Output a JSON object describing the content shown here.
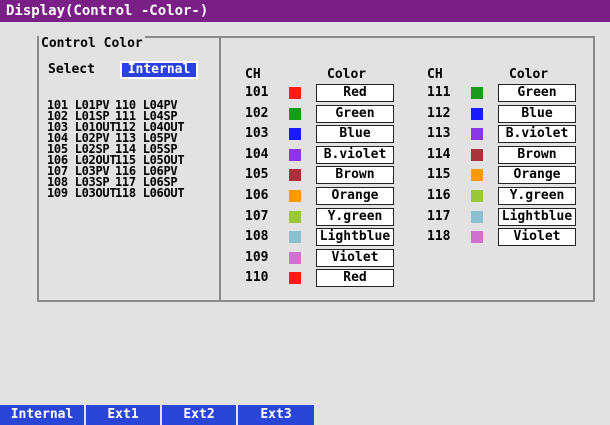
{
  "title": "Display(Control -Color-)",
  "section_label": "Control Color",
  "select": {
    "label": "Select",
    "value": "Internal"
  },
  "tags": [
    [
      "101 L01PV",
      "110 L04PV"
    ],
    [
      "102 L01SP",
      "111 L04SP"
    ],
    [
      "103 L01OUT",
      "112 L04OUT"
    ],
    [
      "104 L02PV",
      "113 L05PV"
    ],
    [
      "105 L02SP",
      "114 L05SP"
    ],
    [
      "106 L02OUT",
      "115 L05OUT"
    ],
    [
      "107 L03PV",
      "116 L06PV"
    ],
    [
      "108 L03SP",
      "117 L06SP"
    ],
    [
      "109 L03OUT",
      "118 L06OUT"
    ]
  ],
  "headers": {
    "ch": "CH",
    "color": "Color"
  },
  "channels_left": [
    {
      "ch": "101",
      "color": "Red",
      "hex": "#ff1a1a"
    },
    {
      "ch": "102",
      "color": "Green",
      "hex": "#1a9a1a"
    },
    {
      "ch": "103",
      "color": "Blue",
      "hex": "#1a1aff"
    },
    {
      "ch": "104",
      "color": "B.violet",
      "hex": "#8a35e6"
    },
    {
      "ch": "105",
      "color": "Brown",
      "hex": "#a8323a"
    },
    {
      "ch": "106",
      "color": "Orange",
      "hex": "#ff9a00"
    },
    {
      "ch": "107",
      "color": "Y.green",
      "hex": "#9ac83a"
    },
    {
      "ch": "108",
      "color": "Lightblue",
      "hex": "#8cbfd0"
    },
    {
      "ch": "109",
      "color": "Violet",
      "hex": "#d070d0"
    },
    {
      "ch": "110",
      "color": "Red",
      "hex": "#ff1a1a"
    }
  ],
  "channels_right": [
    {
      "ch": "111",
      "color": "Green",
      "hex": "#1a9a1a"
    },
    {
      "ch": "112",
      "color": "Blue",
      "hex": "#1a1aff"
    },
    {
      "ch": "113",
      "color": "B.violet",
      "hex": "#8a35e6"
    },
    {
      "ch": "114",
      "color": "Brown",
      "hex": "#a8323a"
    },
    {
      "ch": "115",
      "color": "Orange",
      "hex": "#ff9a00"
    },
    {
      "ch": "116",
      "color": "Y.green",
      "hex": "#9ac83a"
    },
    {
      "ch": "117",
      "color": "Lightblue",
      "hex": "#8cbfd0"
    },
    {
      "ch": "118",
      "color": "Violet",
      "hex": "#d070d0"
    }
  ],
  "softkeys": [
    "Internal",
    "Ext1",
    "Ext2",
    "Ext3"
  ],
  "colors": {
    "title_bg": "#7a1f86",
    "softkey_bg": "#2a46d8",
    "select_bg": "#2a40e0"
  }
}
